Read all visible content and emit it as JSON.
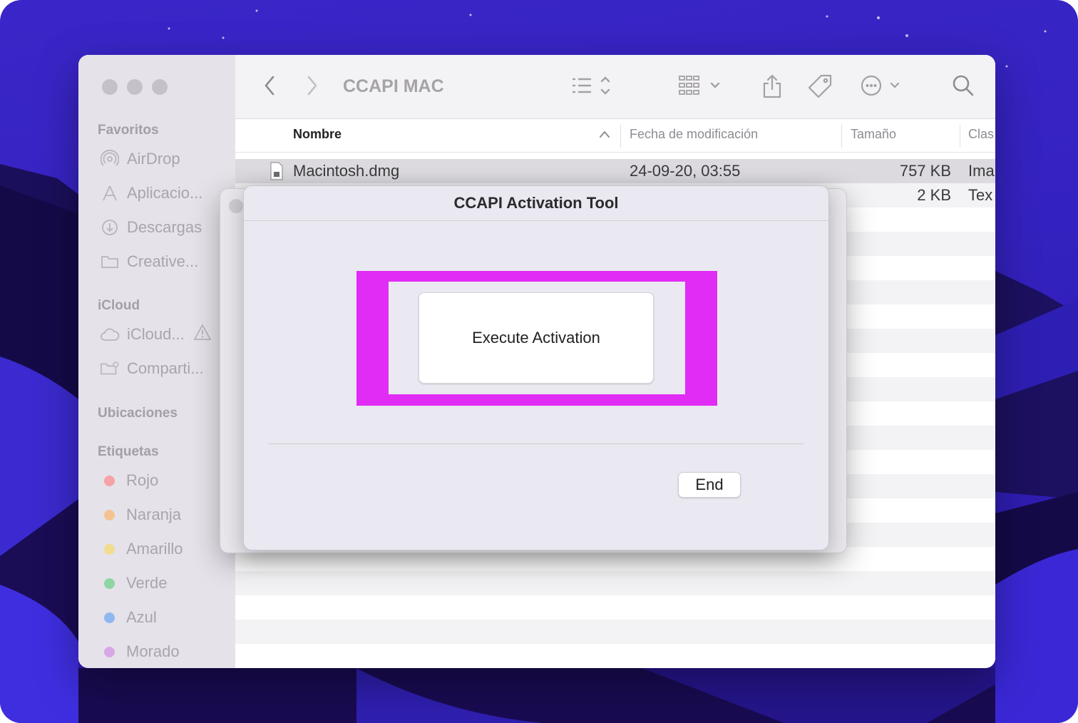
{
  "finder": {
    "window_title": "CCAPI MAC",
    "sidebar": {
      "favorites_heading": "Favoritos",
      "favorites": [
        {
          "label": "AirDrop",
          "icon": "airdrop-icon"
        },
        {
          "label": "Aplicacio...",
          "icon": "applications-icon"
        },
        {
          "label": "Descargas",
          "icon": "downloads-icon"
        },
        {
          "label": "Creative...",
          "icon": "folder-icon"
        }
      ],
      "icloud_heading": "iCloud",
      "icloud": [
        {
          "label": "iCloud...",
          "icon": "icloud-icon",
          "warning": "warning-icon"
        },
        {
          "label": "Comparti...",
          "icon": "shared-folder-icon"
        }
      ],
      "locations_heading": "Ubicaciones",
      "tags_heading": "Etiquetas",
      "tags": [
        {
          "label": "Rojo",
          "color": "#f5a3a8"
        },
        {
          "label": "Naranja",
          "color": "#f3c391"
        },
        {
          "label": "Amarillo",
          "color": "#f0dd8e"
        },
        {
          "label": "Verde",
          "color": "#8fd6a4"
        },
        {
          "label": "Azul",
          "color": "#8fb8f0"
        },
        {
          "label": "Morado",
          "color": "#d7a8e6"
        }
      ]
    },
    "columns": {
      "name": "Nombre",
      "date": "Fecha de modificación",
      "size": "Tamaño",
      "kind": "Clas"
    },
    "files": [
      {
        "name": "Macintosh.dmg",
        "date": "24-09-20, 03:55",
        "size": "757 KB",
        "kind": "Ima"
      },
      {
        "name": "",
        "date": "",
        "size": "2 KB",
        "kind": "Tex"
      }
    ]
  },
  "dialog": {
    "title": "CCAPI Activation Tool",
    "execute_label": "Execute Activation",
    "end_label": "End",
    "highlight_color": "#e02cf5"
  }
}
